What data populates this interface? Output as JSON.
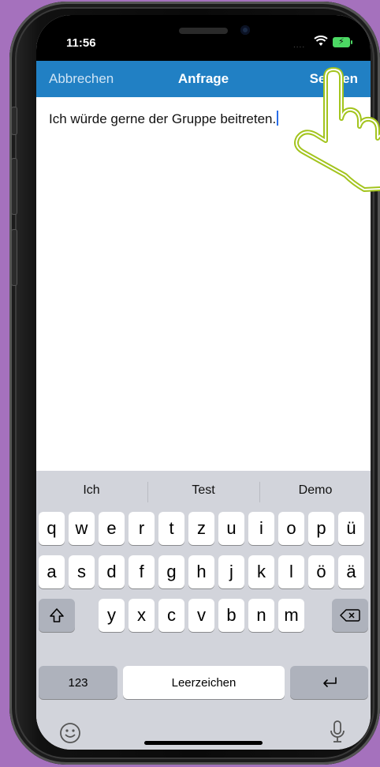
{
  "status_bar": {
    "time": "11:56",
    "signal": "....",
    "wifi_icon": "wifi-icon",
    "battery_icon": "battery-charging-icon"
  },
  "nav": {
    "cancel_label": "Abbrechen",
    "title": "Anfrage",
    "send_label": "Senden"
  },
  "message": {
    "text": "Ich würde gerne der Gruppe beitreten."
  },
  "keyboard": {
    "suggestions": [
      "Ich",
      "Test",
      "Demo"
    ],
    "row1": [
      "q",
      "w",
      "e",
      "r",
      "t",
      "z",
      "u",
      "i",
      "o",
      "p",
      "ü"
    ],
    "row2": [
      "a",
      "s",
      "d",
      "f",
      "g",
      "h",
      "j",
      "k",
      "l",
      "ö",
      "ä"
    ],
    "row3": [
      "y",
      "x",
      "c",
      "v",
      "b",
      "n",
      "m"
    ],
    "numbers_label": "123",
    "space_label": "Leerzeichen",
    "shift_icon": "shift-icon",
    "backspace_icon": "backspace-icon",
    "return_icon": "return-icon",
    "emoji_icon": "emoji-icon",
    "mic_icon": "microphone-icon"
  },
  "colors": {
    "nav_blue": "#2180c4",
    "background_purple": "#a571bd",
    "hand_outline": "#a3c41d"
  }
}
